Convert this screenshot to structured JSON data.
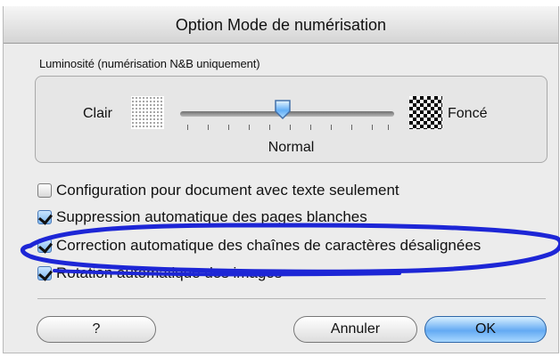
{
  "dialog": {
    "title": "Option Mode de numérisation"
  },
  "brightness": {
    "group_label": "Luminosité (numérisation N&B uniquement)",
    "light_label": "Clair",
    "dark_label": "Foncé",
    "value_label": "Normal",
    "slider_level": 0.5
  },
  "options": [
    {
      "label": "Configuration pour document avec texte seulement",
      "checked": false
    },
    {
      "label": "Suppression automatique des pages blanches",
      "checked": true
    },
    {
      "label": "Correction automatique des chaînes de caractères désalignées",
      "checked": true
    },
    {
      "label": "Rotation automatique des images",
      "checked": true
    }
  ],
  "buttons": {
    "help": "?",
    "cancel": "Annuler",
    "ok": "OK"
  },
  "colors": {
    "annotation": "#1d26d6",
    "default_button": "#63aaf3",
    "checkbox_checked": "#7fb8f0"
  },
  "icons": {
    "light_pattern": "light-pattern-icon",
    "dark_pattern": "dark-pattern-icon",
    "slider_thumb": "slider-thumb-icon",
    "checkmark": "checkmark-icon"
  }
}
